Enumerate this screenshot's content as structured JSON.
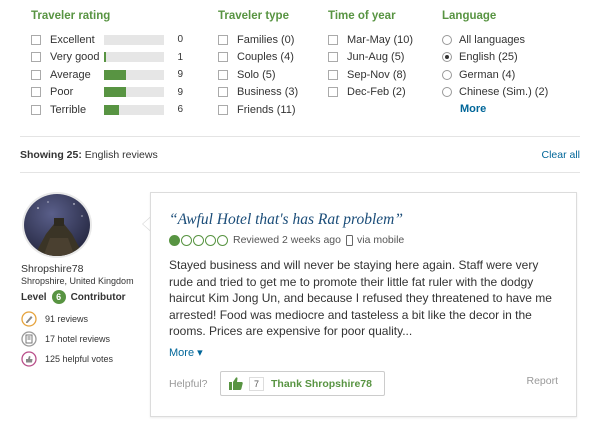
{
  "filters": {
    "rating": {
      "title": "Traveler rating",
      "items": [
        {
          "label": "Excellent",
          "count": "0",
          "fraction": 0.0
        },
        {
          "label": "Very good",
          "count": "1",
          "fraction": 0.04
        },
        {
          "label": "Average",
          "count": "9",
          "fraction": 0.37
        },
        {
          "label": "Poor",
          "count": "9",
          "fraction": 0.37
        },
        {
          "label": "Terrible",
          "count": "6",
          "fraction": 0.25
        }
      ]
    },
    "type": {
      "title": "Traveler type",
      "items": [
        "Families (0)",
        "Couples (4)",
        "Solo (5)",
        "Business (3)",
        "Friends (11)"
      ]
    },
    "time": {
      "title": "Time of year",
      "items": [
        "Mar-May (10)",
        "Jun-Aug (5)",
        "Sep-Nov (8)",
        "Dec-Feb (2)"
      ]
    },
    "language": {
      "title": "Language",
      "items": [
        "All languages",
        "English (25)",
        "German (4)",
        "Chinese (Sim.) (2)"
      ],
      "selected": "English (25)",
      "more": "More"
    }
  },
  "showing": {
    "prefix": "Showing 25:",
    "text": " English reviews"
  },
  "clear_all": "Clear all",
  "reviewer": {
    "name": "Shropshire78",
    "location": "Shropshire, United Kingdom",
    "level_prefix": "Level",
    "level": "6",
    "level_suffix": "Contributor",
    "stats": [
      "91 reviews",
      "17 hotel reviews",
      "125 helpful votes"
    ]
  },
  "review": {
    "title": "“Awful Hotel that's has Rat problem”",
    "rating": 1,
    "rating_max": 5,
    "date": "Reviewed 2 weeks ago",
    "via": "via mobile",
    "body": "Stayed business and will never be staying here again. Staff were very rude and tried to get me to promote their little fat ruler with the dodgy haircut Kim Jong Un, and because I refused they threatened to have me arrested! Food was mediocre and tasteless a bit like the decor in the rooms. Prices are expensive for poor quality...",
    "more": "More ▾",
    "helpful": "Helpful?",
    "thank_count": "7",
    "thank_label": "Thank Shropshire78",
    "report": "Report"
  },
  "colors": {
    "accent_green": "#589442",
    "link_blue": "#006699",
    "title_blue": "#1a4c78"
  }
}
